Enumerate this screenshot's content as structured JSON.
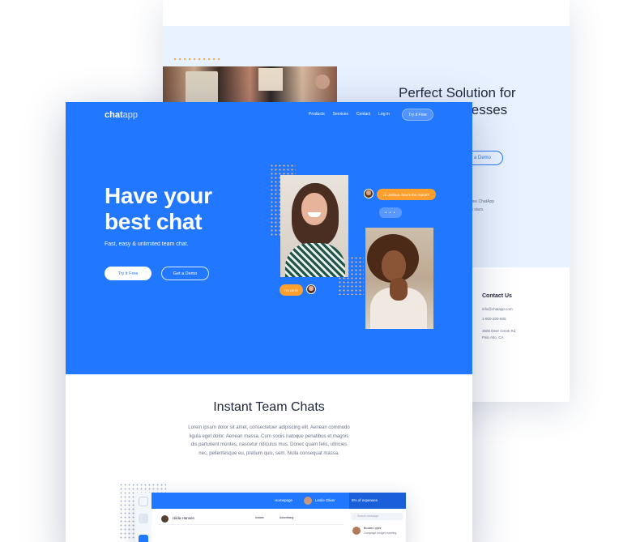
{
  "colors": {
    "brand": "#2277ff",
    "accent": "#ff9f2d",
    "text": "#23293d"
  },
  "back_page": {
    "title": "Perfect Solution for\nSmall Businesses",
    "demo_button": "Get a Demo",
    "desc_line1": "use ChatApp",
    "desc_line2": "5 stars.",
    "contact_title": "Contact Us",
    "contact_email": "info@chatapp.com",
    "contact_phone": "1-800-200-505",
    "contact_addr1": "3500 Deer Creek Rd",
    "contact_addr2": "Palo Alto, CA"
  },
  "header": {
    "logo_bold": "chat",
    "logo_light": "app",
    "nav": [
      "Products",
      "Services",
      "Contact",
      "Log in"
    ],
    "try_button": "Try it Free"
  },
  "hero": {
    "headline_line1": "Have your",
    "headline_line2": "best chat",
    "subline": "Fast, easy & unlimited team chat.",
    "primary_button": "Try it Free",
    "secondary_button": "Get a Demo",
    "bubble1": "Hi Joshua, how's the report?",
    "typing": "• • •",
    "bubble2": "I'm on it!"
  },
  "features": {
    "title": "Instant Team Chats",
    "body": "Lorem ipsum dolor sit amet, consectetuer adipiscing elit. Aenean commodo ligula eget dolor. Aenean massa. Cum sociis natoque penatibus et magnis dis parturient montes, nascetur ridiculus mus. Donec quam felis, ultricies nec, pellentesque eu, pretium quis, sem. Nulla consequat massa."
  },
  "app_preview": {
    "homepage": "Homepage",
    "user": "Leslie Oliver",
    "stat": "5% of expenses",
    "contact_name": "Hilda Hansen",
    "col1": "Instant",
    "col2": "Advertising",
    "search_placeholder": "Search message",
    "msg_name": "Brooke Lopez",
    "msg_text": "Compage budget meeting"
  }
}
